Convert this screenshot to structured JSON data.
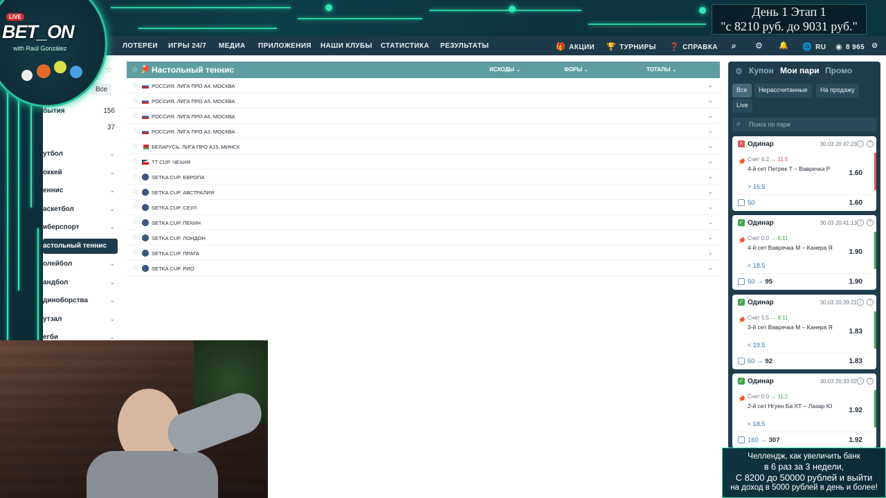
{
  "overlay": {
    "stage_line1": "День 1  Этап 1",
    "stage_line2": "\"с 8210 руб. до 9031 руб.\"",
    "logo_live": "LIVE",
    "logo_brand": "BET_ON",
    "logo_sub": "with Raúl González",
    "challenge_lines": [
      "Челлендж, как увеличить банк",
      "в 6 раз за 3 недели,",
      "С 8200 до 50000 рублей и выйти",
      "на доход в 5000 рублей в день и более!"
    ]
  },
  "nav": {
    "items": [
      "ЛОТЕРЕИ",
      "ИГРЫ 24/7",
      "МЕДИА",
      "ПРИЛОЖЕНИЯ",
      "НАШИ КЛУБЫ",
      "СТАТИСТИКА",
      "РЕЗУЛЬТАТЫ"
    ],
    "promo": "АКЦИИ",
    "tournaments": "ТУРНИРЫ",
    "help": "СПРАВКА",
    "lang": "RU",
    "balance": "8 965"
  },
  "sidebar": {
    "all_label": "Все",
    "counts": [
      {
        "label": "бытия",
        "count": "156"
      },
      {
        "label": "",
        "count": "37"
      }
    ],
    "sports": [
      "утбол",
      "оккей",
      "еннис",
      "аскетбол",
      "иберспорт",
      "астольный теннис",
      "олейбол",
      "андбол",
      "диноборства",
      "утзал",
      "егби"
    ],
    "active_index": 5
  },
  "main": {
    "title": "Настольный теннис",
    "columns": [
      "ИСХОДЫ",
      "ФОРЫ",
      "ТОТАЛЫ"
    ],
    "leagues": [
      {
        "name": "РОССИЯ. ЛИГА ПРО А4. МОСКВА",
        "flag": "ru"
      },
      {
        "name": "РОССИЯ. ЛИГА ПРО А5. МОСКВА",
        "flag": "ru"
      },
      {
        "name": "РОССИЯ. ЛИГА ПРО А6. МОСКВА",
        "flag": "ru"
      },
      {
        "name": "РОССИЯ. ЛИГА ПРО А3. МОСКВА",
        "flag": "ru"
      },
      {
        "name": "БЕЛАРУСЬ. ЛИГА ПРО А15. МИНСК",
        "flag": "by"
      },
      {
        "name": "TT CUP. ЧЕХИЯ",
        "flag": "cz"
      },
      {
        "name": "SETKA CUP. ЕВРОПА",
        "flag": "setka"
      },
      {
        "name": "SETKA CUP. АВСТРАЛИЯ",
        "flag": "setka"
      },
      {
        "name": "SETKA CUP. СЕУЛ",
        "flag": "setka"
      },
      {
        "name": "SETKA CUP. ПЕКИН",
        "flag": "setka"
      },
      {
        "name": "SETKA CUP. ЛОНДОН",
        "flag": "setka"
      },
      {
        "name": "SETKA CUP. ПРАГА",
        "flag": "setka"
      },
      {
        "name": "SETKA CUP. РИО",
        "flag": "setka"
      }
    ]
  },
  "coupon": {
    "tabs": [
      "Купон",
      "Мои пари",
      "Промо"
    ],
    "active_tab": "Мои пари",
    "filters": [
      "Все",
      "Нерассчитанные",
      "На продажу",
      "Live"
    ],
    "search_placeholder": "Поиск по пари",
    "bets": [
      {
        "status": "lose",
        "type": "Одинар",
        "date": "30.03 20:47:23",
        "score_from": "Счет 6:2",
        "score_to": "11:5",
        "event": "4-й сет Петрек Т – Вавречка Р",
        "pick": "> 16.5",
        "odd": "1.60",
        "stake": "50",
        "payout": "",
        "foot_odd": "1.60"
      },
      {
        "status": "win",
        "type": "Одинар",
        "date": "30.03 20:41:13",
        "score_from": "Счет 0:0",
        "score_to": "6:11",
        "event": "4-й сет Вавречка М – Канера Я",
        "pick": "< 18.5",
        "odd": "1.90",
        "stake": "50",
        "payout": "95",
        "foot_odd": "1.90"
      },
      {
        "status": "win",
        "type": "Одинар",
        "date": "30.03 20:39:21",
        "score_from": "Счет 5:5",
        "score_to": "8:11",
        "event": "3-й сет Вавречка М – Канера Я",
        "pick": "< 19.5",
        "odd": "1.83",
        "stake": "50",
        "payout": "92",
        "foot_odd": "1.83"
      },
      {
        "status": "win",
        "type": "Одинар",
        "date": "30.03 20:33:02",
        "score_from": "Счет 0:0",
        "score_to": "11:2",
        "event": "2-й сет Нгуен Ба ХТ – Лазар Ю",
        "pick": "< 18.5",
        "odd": "1.92",
        "stake": "160",
        "payout": "307",
        "foot_odd": "1.92"
      }
    ]
  },
  "colors": {
    "accent": "#5e9ea0",
    "nav": "#1d3a4a",
    "coupon": "#1f3d4c",
    "neon": "#2ee9b0",
    "win": "#3ea84f",
    "lose": "#e05656"
  }
}
